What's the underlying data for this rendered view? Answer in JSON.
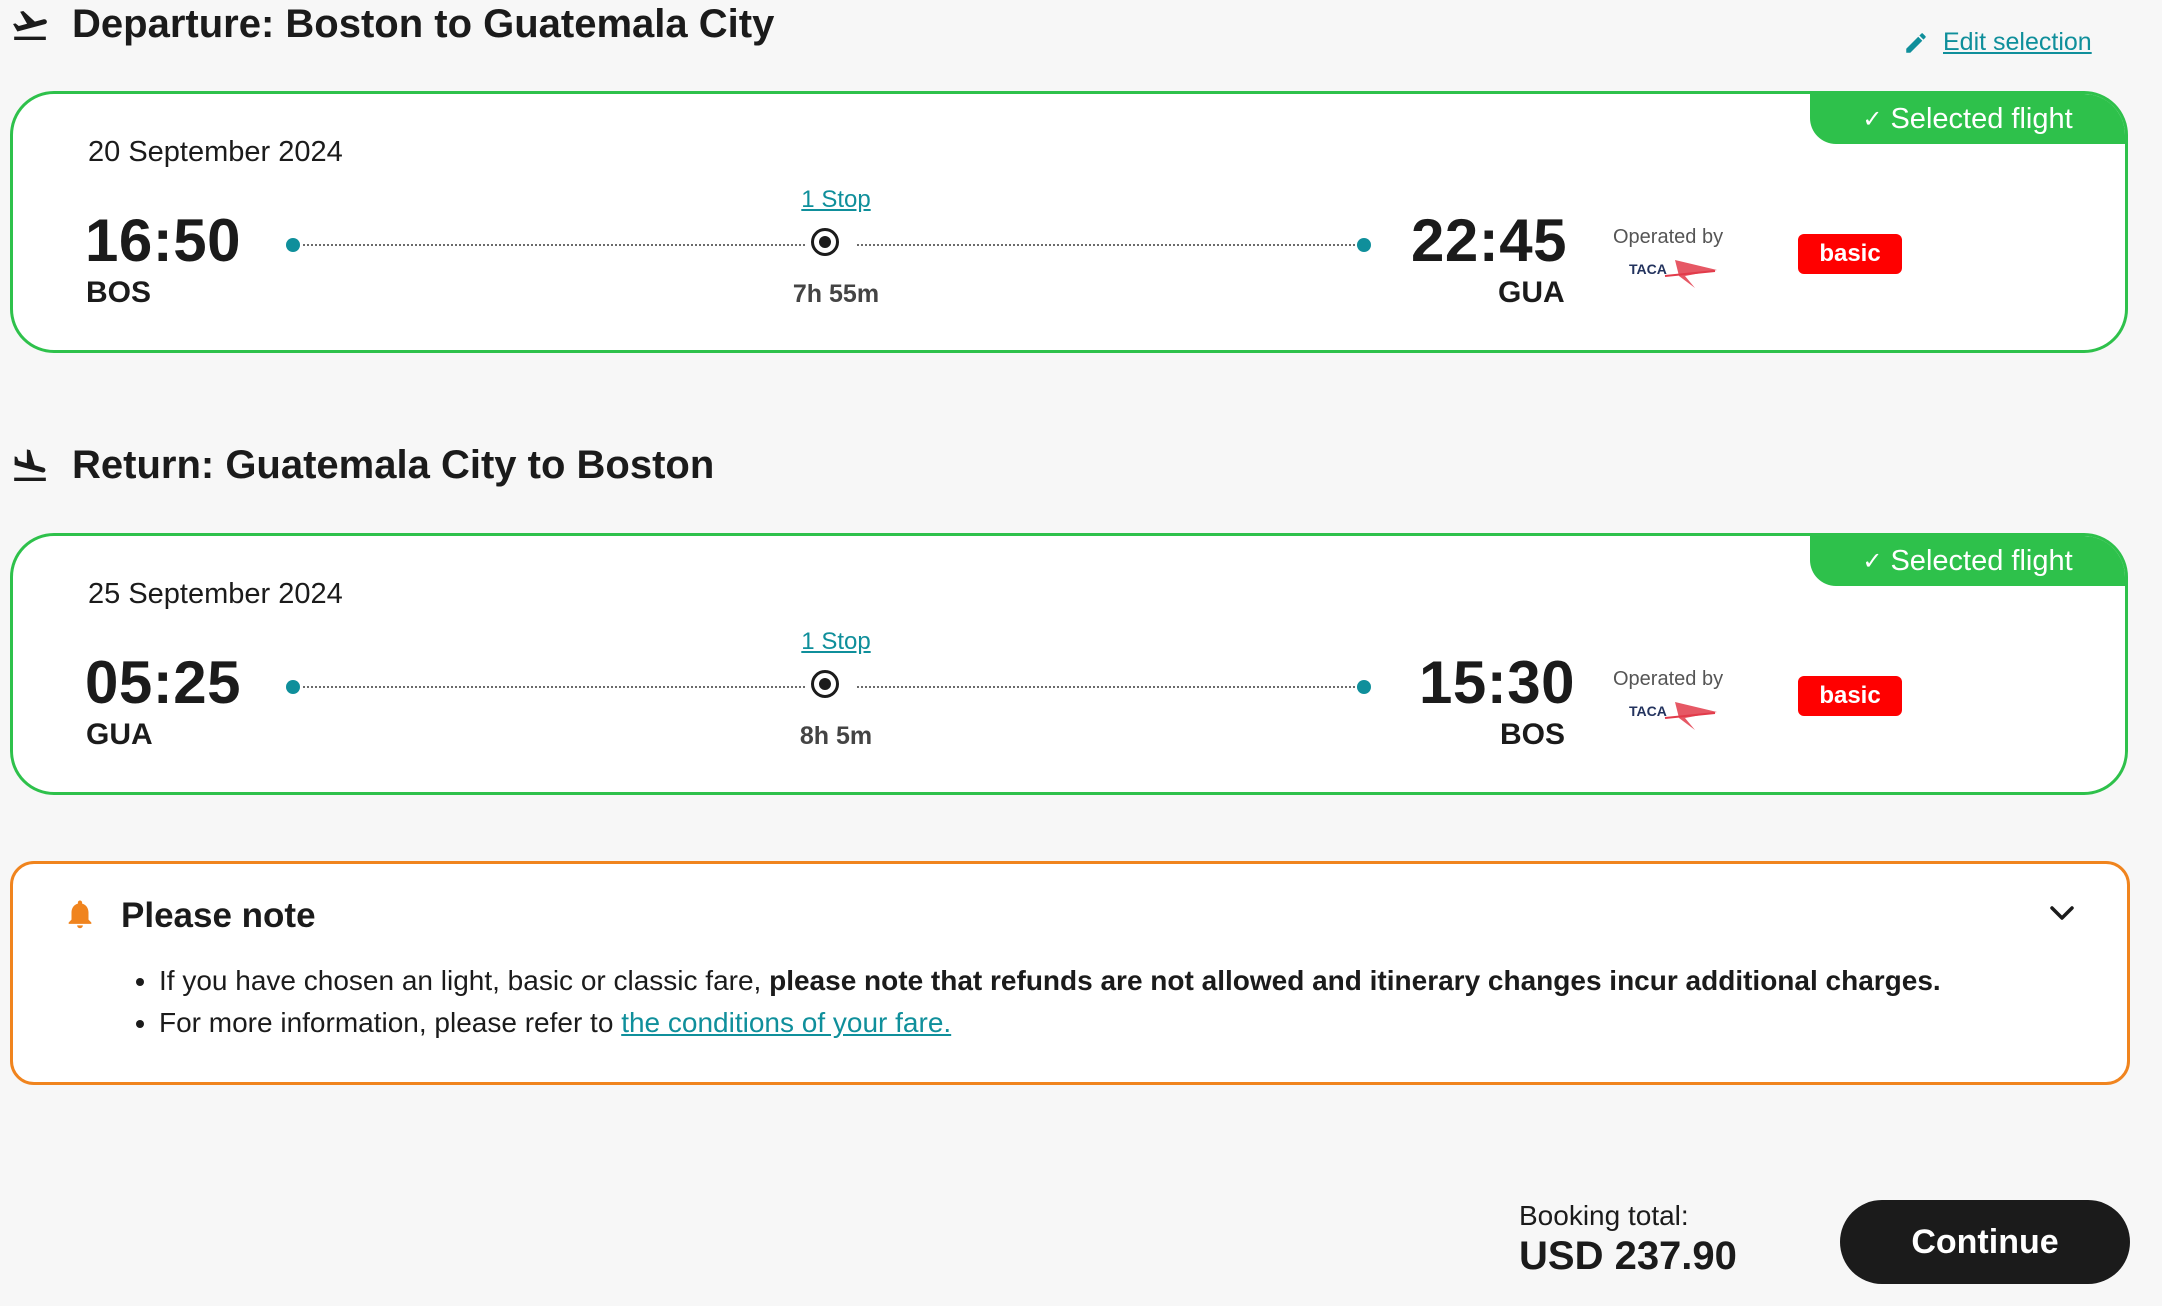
{
  "departure": {
    "heading": "Departure: Boston to Guatemala City",
    "edit_label": "Edit selection",
    "selected_label": "Selected flight",
    "date": "20 September 2024",
    "dep_time": "16:50",
    "dep_airport": "BOS",
    "stops": "1 Stop",
    "duration": "7h 55m",
    "arr_time": "22:45",
    "arr_airport": "GUA",
    "operated_by": "Operated by",
    "airline": "TACA",
    "fare": "basic"
  },
  "return": {
    "heading": "Return: Guatemala City to Boston",
    "selected_label": "Selected flight",
    "date": "25 September 2024",
    "dep_time": "05:25",
    "dep_airport": "GUA",
    "stops": "1 Stop",
    "duration": "8h 5m",
    "arr_time": "15:30",
    "arr_airport": "BOS",
    "operated_by": "Operated by",
    "airline": "TACA",
    "fare": "basic"
  },
  "note": {
    "title": "Please note",
    "line1_prefix": "If you have chosen an light, basic or classic fare, ",
    "line1_bold": "please note that refunds are not allowed and itinerary changes incur additional charges.",
    "line2_prefix": "For more information, please refer to ",
    "line2_link": "the conditions of your fare."
  },
  "footer": {
    "total_label": "Booking total:",
    "total_amount": "USD 237.90",
    "continue_label": "Continue"
  },
  "colors": {
    "selected_green": "#2ec14b",
    "accent_teal": "#0f8f9b",
    "fare_red": "#ff0000",
    "note_orange": "#f0841e"
  },
  "icons": {
    "departure": "takeoff-plane-icon",
    "return": "landing-plane-icon",
    "edit": "pencil-icon",
    "note": "bell-icon",
    "expand": "chevron-down-icon",
    "selected": "checkmark-icon"
  }
}
